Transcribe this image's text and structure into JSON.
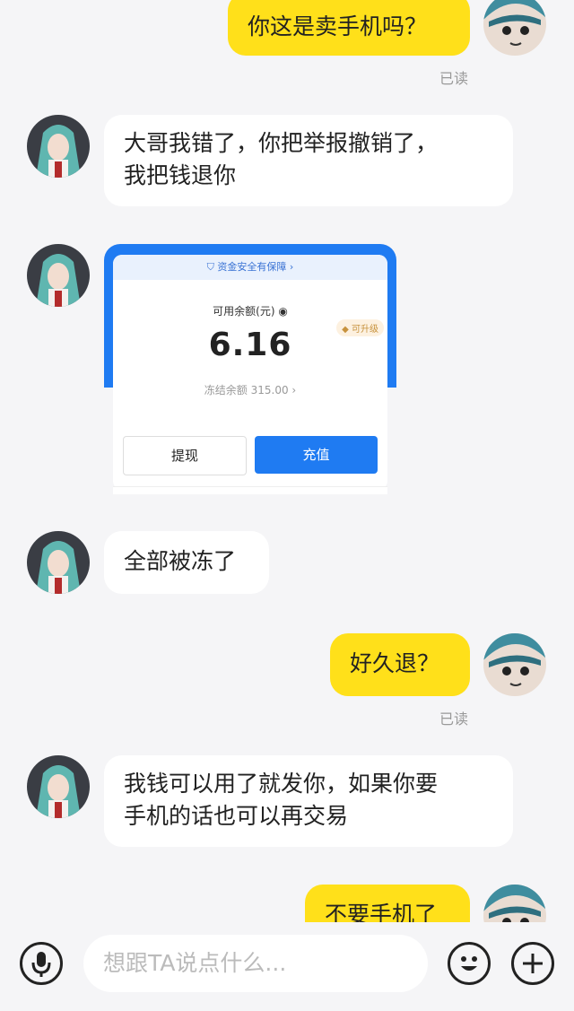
{
  "messages": [
    {
      "from": "me",
      "text": "你这是卖手机吗？",
      "status": "已读"
    },
    {
      "from": "other",
      "text_lines": [
        "大哥我错了，你把举报撤销了，",
        "我把钱退你"
      ]
    },
    {
      "from": "other",
      "type": "wallet-card"
    },
    {
      "from": "other",
      "text": "全部被冻了"
    },
    {
      "from": "me",
      "text": "好久退？",
      "status": "已读"
    },
    {
      "from": "other",
      "text_lines": [
        "我钱可以用了就发你，如果你要",
        "手机的话也可以再交易"
      ]
    },
    {
      "from": "me",
      "text": "不要手机了"
    }
  ],
  "wallet": {
    "banner": "资金安全有保障 ›",
    "balance_label": "可用余额(元)",
    "amount": "6.16",
    "upgrade": "可升级",
    "frozen": "冻结余额 315.00 ›",
    "withdraw": "提现",
    "recharge": "充值"
  },
  "input": {
    "placeholder": "想跟TA说点什么..."
  },
  "icons": {
    "voice": "microphone-icon",
    "emoji": "emoji-icon",
    "add": "plus-icon"
  },
  "colors": {
    "my_bubble": "#ffe01a",
    "other_bubble": "#ffffff",
    "background": "#f5f5f7",
    "wallet_blue": "#1f7bf2"
  }
}
